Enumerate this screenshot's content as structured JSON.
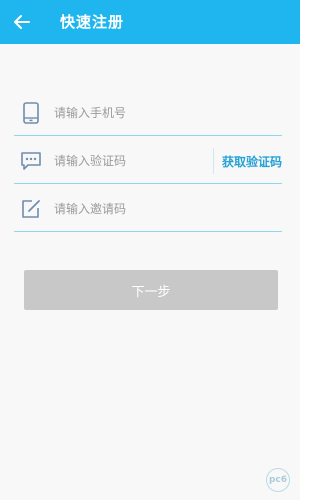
{
  "header": {
    "title": "快速注册",
    "back_icon": "arrow-left-icon",
    "background": "#1fb6f0"
  },
  "form": {
    "phone": {
      "placeholder": "请输入手机号",
      "icon": "phone-icon"
    },
    "code": {
      "placeholder": "请输入验证码",
      "icon": "message-icon",
      "get_code_label": "获取验证码"
    },
    "invite": {
      "placeholder": "请输入邀请码",
      "icon": "edit-icon"
    }
  },
  "next_button": {
    "label": "下一步",
    "state": "disabled"
  },
  "watermark": {
    "text": "pc6"
  },
  "colors": {
    "accent": "#1fb6f0",
    "link": "#27a2d6",
    "divider": "#8fd6ef",
    "disabled_button": "#c8c8c8"
  }
}
